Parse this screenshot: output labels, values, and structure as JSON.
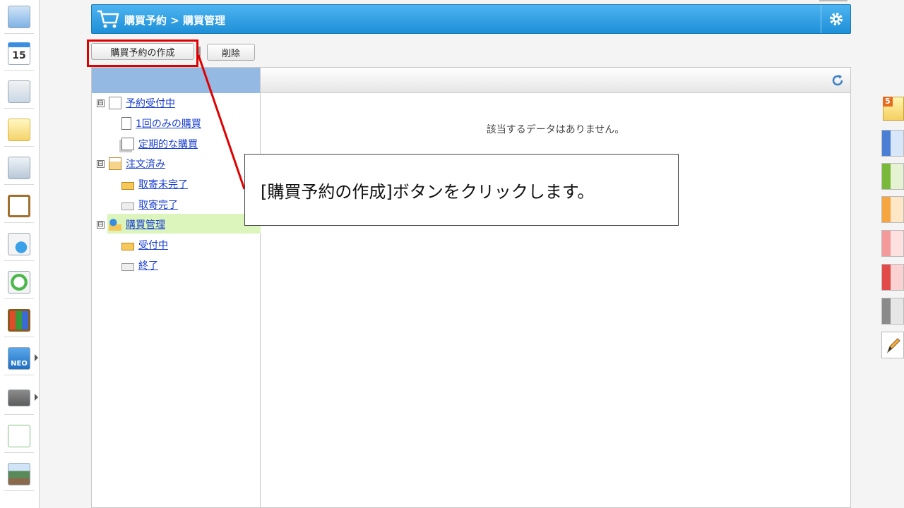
{
  "header": {
    "title": "購買予約 > 購買管理",
    "brand_color": "#1e8fd8",
    "cart_icon": "cart-icon",
    "settings_icon": "gear-icon"
  },
  "toolbar": {
    "create_label": "購買予約の作成",
    "delete_label": "削除"
  },
  "tree": {
    "groups": [
      {
        "label": "予約受付中",
        "expander": "⊟",
        "icon": "edit-note-icon",
        "children": [
          {
            "label": "1回のみの購買",
            "icon": "clipboard-icon"
          },
          {
            "label": "定期的な購買",
            "icon": "clipboard-stack-icon"
          }
        ]
      },
      {
        "label": "注文済み",
        "expander": "⊟",
        "icon": "order-folder-icon",
        "children": [
          {
            "label": "取寄未完了",
            "icon": "folder-icon"
          },
          {
            "label": "取寄完了",
            "icon": "folder-gray-icon"
          }
        ]
      },
      {
        "label": "購買管理",
        "expander": "⊟",
        "icon": "user-folder-icon",
        "children": [
          {
            "label": "受付中",
            "icon": "folder-icon"
          },
          {
            "label": "終了",
            "icon": "folder-gray-icon"
          }
        ]
      }
    ],
    "selected_color": "#dcf5bd"
  },
  "main": {
    "empty_message": "該当するデータはありません。",
    "refresh_icon": "refresh-icon"
  },
  "callout": {
    "text": "[購買予約の作成]ボタンをクリックします。",
    "highlight_color": "#e00000"
  },
  "left_rail": {
    "items": [
      {
        "icon": "portal-icon"
      },
      {
        "icon": "calendar-icon",
        "text": "15"
      },
      {
        "icon": "report-icon"
      },
      {
        "icon": "memo-icon"
      },
      {
        "icon": "bulletin-icon"
      },
      {
        "icon": "clipboard-icon"
      },
      {
        "icon": "search-doc-icon"
      },
      {
        "icon": "sync-icon"
      },
      {
        "icon": "binder-icon"
      },
      {
        "icon": "neo-chart-icon",
        "text": "NEO"
      },
      {
        "icon": "folder-icon"
      },
      {
        "icon": "tanomail-icon"
      },
      {
        "icon": "banner-icon"
      }
    ]
  },
  "right_rail": {
    "items": [
      {
        "icon": "notes-icon",
        "badge": "5"
      },
      {
        "color": "#4a7fd4"
      },
      {
        "color": "#7ab83a"
      },
      {
        "color": "#f5a640"
      },
      {
        "color": "#f59a9a"
      },
      {
        "color": "#e24a4a"
      },
      {
        "color": "#8a8a8a"
      },
      {
        "icon": "pencil-icon"
      }
    ]
  }
}
